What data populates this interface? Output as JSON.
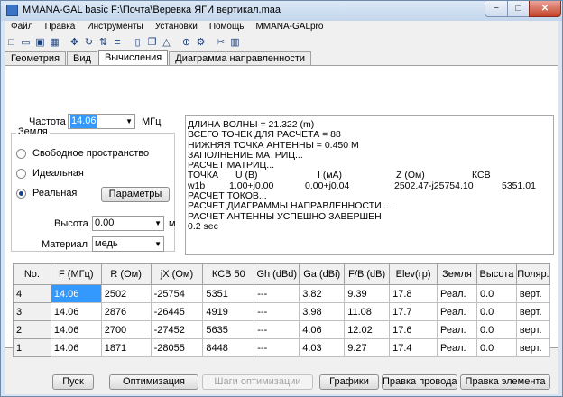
{
  "window": {
    "title": "MMANA-GAL basic F:\\Почта\\Веревка ЯГИ вертикал.maa",
    "min_glyph": "−",
    "max_glyph": "□",
    "close_glyph": "✕"
  },
  "menu": [
    "Файл",
    "Правка",
    "Инструменты",
    "Установки",
    "Помощь",
    "MMANA-GALpro"
  ],
  "toolbar": [
    {
      "name": "new-file-icon",
      "glyph": "□"
    },
    {
      "name": "open-file-icon",
      "glyph": "▭"
    },
    {
      "name": "save-icon",
      "glyph": "▣"
    },
    {
      "name": "save-all-icon",
      "glyph": "▦"
    },
    {
      "name": "move-icon",
      "glyph": "✥"
    },
    {
      "name": "rotate-icon",
      "glyph": "↻"
    },
    {
      "name": "flip-icon",
      "glyph": "⇅"
    },
    {
      "name": "wires-icon",
      "glyph": "≡"
    },
    {
      "name": "document-icon",
      "glyph": "▯"
    },
    {
      "name": "copy-icon",
      "glyph": "❐"
    },
    {
      "name": "triangle-icon",
      "glyph": "△"
    },
    {
      "name": "target-icon",
      "glyph": "⊕"
    },
    {
      "name": "gear-icon",
      "glyph": "⚙"
    },
    {
      "name": "tools-icon",
      "glyph": "✂"
    },
    {
      "name": "calculator-icon",
      "glyph": "▥"
    }
  ],
  "tabs": [
    "Геометрия",
    "Вид",
    "Вычисления",
    "Диаграмма направленности"
  ],
  "active_tab": 2,
  "frequency": {
    "label": "Частота",
    "value": "14.06",
    "unit": "МГц"
  },
  "ground": {
    "title": "Земля",
    "options": [
      "Свободное пространство",
      "Идеальная",
      "Реальная"
    ],
    "selected": 2,
    "params_button": "Параметры"
  },
  "height": {
    "label": "Высота",
    "value": "0.00",
    "unit": "м"
  },
  "material": {
    "label": "Материал",
    "value": "медь"
  },
  "results": {
    "lines": [
      "ДЛИНА ВОЛНЫ = 21.322 (m)",
      "ВСЕГО ТОЧЕК ДЛЯ РАСЧЕТА = 88",
      "НИЖНЯЯ ТОЧКА АНТЕННЫ = 0.450 М",
      "ЗАПОЛНЕНИЕ МАТРИЦ...",
      "РАСЧЕТ МАТРИЦ..."
    ],
    "point_header": [
      "ТОЧКА",
      "U (B)",
      "I (мА)",
      "Z (Ом)",
      "КСВ"
    ],
    "point_row": [
      "w1b",
      "1.00+j0.00",
      "0.00+j0.04",
      "2502.47-j25754.10",
      "5351.01"
    ],
    "tail_lines": [
      "РАСЧЕТ ТОКОВ...",
      "РАСЧЕТ ДИАГРАММЫ НАПРАВЛЕННОСТИ ...",
      "РАСЧЕТ АНТЕННЫ УСПЕШНО ЗАВЕРШЕН",
      "0.2 sec"
    ]
  },
  "table": {
    "headers": [
      "No.",
      "F (МГц)",
      "R (Ом)",
      "jX (Ом)",
      "КСВ 50",
      "Gh (dBd)",
      "Ga (dBi)",
      "F/B (dB)",
      "Elev(гр)",
      "Земля",
      "Высота",
      "Поляр."
    ],
    "rows": [
      [
        "4",
        "14.06",
        "2502",
        "-25754",
        "5351",
        "---",
        "3.82",
        "9.39",
        "17.8",
        "Реал.",
        "0.0",
        "верт."
      ],
      [
        "3",
        "14.06",
        "2876",
        "-26445",
        "4919",
        "---",
        "3.98",
        "11.08",
        "17.7",
        "Реал.",
        "0.0",
        "верт."
      ],
      [
        "2",
        "14.06",
        "2700",
        "-27452",
        "5635",
        "---",
        "4.06",
        "12.02",
        "17.6",
        "Реал.",
        "0.0",
        "верт."
      ],
      [
        "1",
        "14.06",
        "1871",
        "-28055",
        "8448",
        "---",
        "4.03",
        "9.27",
        "17.4",
        "Реал.",
        "0.0",
        "верт."
      ]
    ]
  },
  "buttons": {
    "start": "Пуск",
    "optimize": "Оптимизация",
    "opt_steps": "Шаги оптимизации",
    "graphs": "Графики",
    "edit_wire": "Правка провода",
    "edit_element": "Правка элемента"
  }
}
